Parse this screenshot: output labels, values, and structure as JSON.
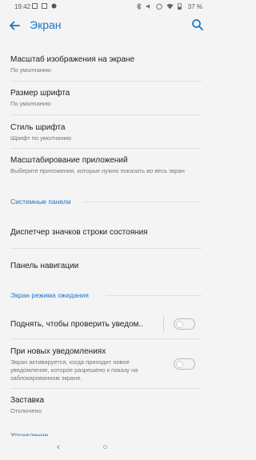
{
  "status_bar": {
    "time": "19:42",
    "battery": "37 %"
  },
  "app_bar": {
    "title": "Экран",
    "back_icon": "arrow-back-icon",
    "search_icon": "search-icon"
  },
  "colors": {
    "accent": "#1a73c8",
    "background": "#f4f4f4"
  },
  "items": {
    "display_scale": {
      "title": "Масштаб изображения на экране",
      "summary": "По умолчанию"
    },
    "font_size": {
      "title": "Размер шрифта",
      "summary": "По умолчанию"
    },
    "font_style": {
      "title": "Стиль шрифта",
      "summary": "Шрифт по умолчанию"
    },
    "app_scaling": {
      "title": "Масштабирование приложений",
      "summary": "Выберите приложения, которые нужно показать во весь экран"
    },
    "system_panels_header": "Системные панели",
    "status_bar_icons": {
      "title": "Диспетчер значков строки состояния"
    },
    "navigation_panel": {
      "title": "Панель навигации"
    },
    "standby_header": "Экран режима ожидания",
    "lift_to_check": {
      "title": "Поднять, чтобы проверить уведом..",
      "enabled": false
    },
    "new_notifications": {
      "title": "При новых уведомлениях",
      "summary": "Экран активируется, когда приходит новое уведомление, которое разрешено к показу на заблокированном экране.",
      "enabled": false
    },
    "screensaver": {
      "title": "Заставка",
      "summary": "Отключено"
    },
    "next_header": "Управление ..."
  },
  "nav_bar": {
    "back": "‹",
    "home": "○"
  }
}
